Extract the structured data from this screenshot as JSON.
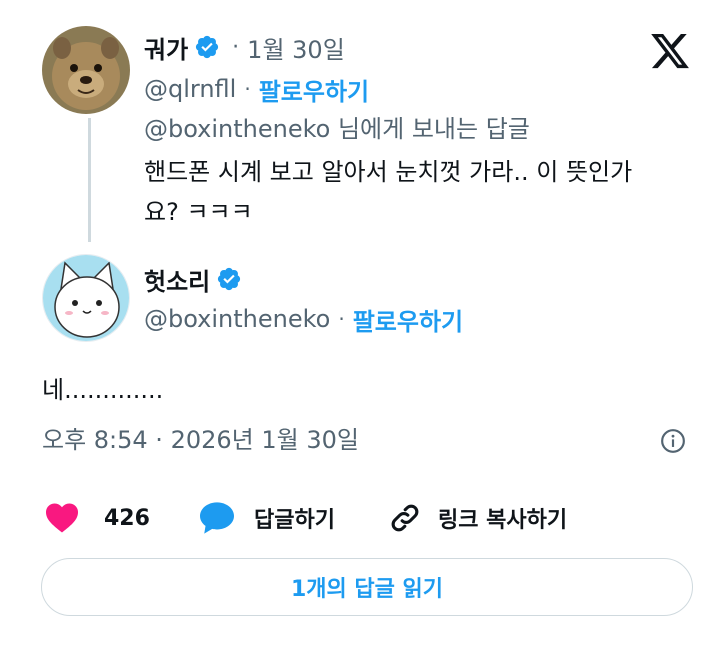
{
  "reply_post": {
    "name": "궈가",
    "separator": "·",
    "date": "1월 30일",
    "handle": "@qlrnfll",
    "follow_separator": "·",
    "follow_label": "팔로우하기",
    "replying_to": "@boxintheneko 님에게 보내는 답글",
    "text_line1": "핸드폰 시계 보고 알아서 눈치껏 가라.. 이 뜻인가",
    "text_line2": "요? ㅋㅋㅋ"
  },
  "main_post": {
    "name": "헛소리",
    "handle": "@boxintheneko",
    "follow_separator": "·",
    "follow_label": "팔로우하기",
    "text": "네.............",
    "timestamp": "오후 8:54 · 2026년 1월 30일"
  },
  "actions": {
    "likes_count": "426",
    "reply_label": "답글하기",
    "copy_link_label": "링크 복사하기"
  },
  "read_replies_label": "1개의 답글 읽기",
  "colors": {
    "accent": "#1d9bf0",
    "like": "#f91880",
    "muted": "#536471",
    "text": "#0f1419"
  }
}
